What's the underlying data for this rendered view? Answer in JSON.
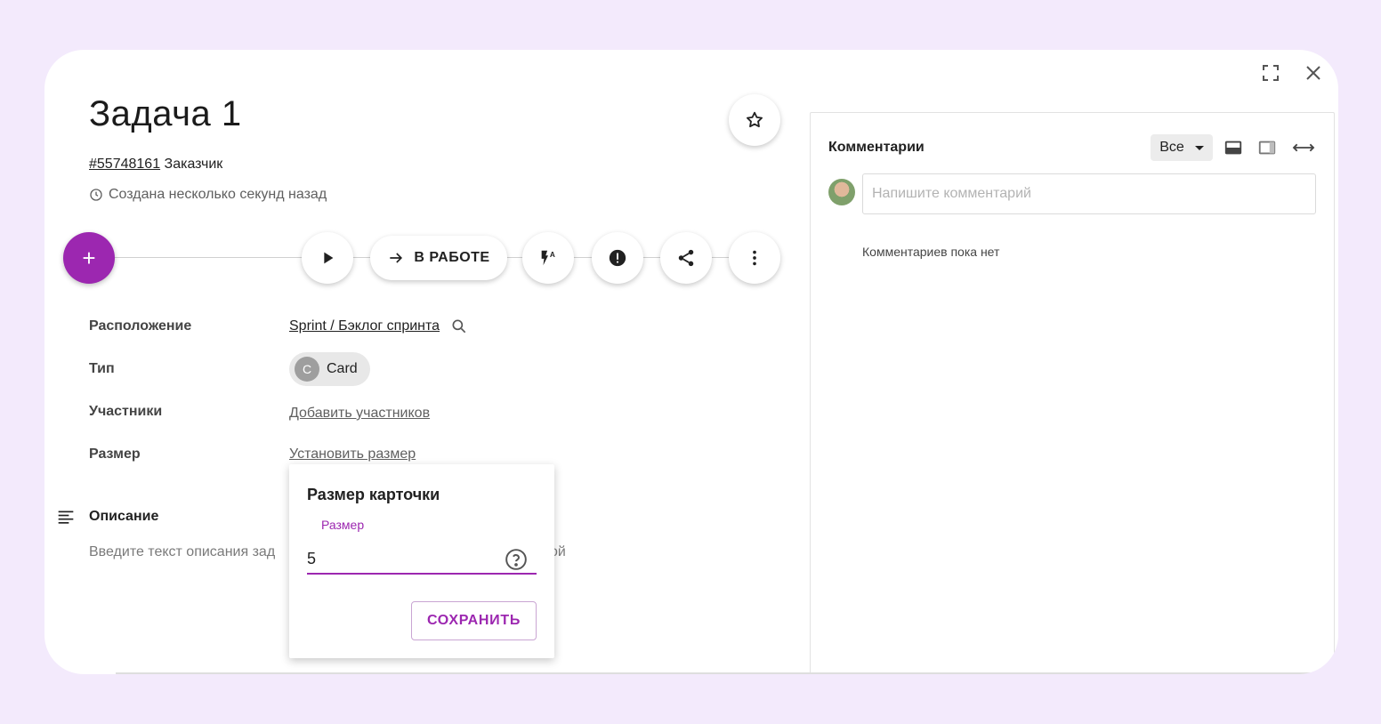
{
  "task": {
    "title": "Задача 1",
    "id": "#55748161",
    "customer": "Заказчик",
    "created": "Создана несколько секунд назад"
  },
  "actions": {
    "add_label": "+",
    "status_label": "В РАБОТЕ"
  },
  "fields": {
    "location_label": "Расположение",
    "location_value": "Sprint / Бэклог спринта",
    "type_label": "Тип",
    "type_initial": "C",
    "type_value": "Card",
    "members_label": "Участники",
    "members_value": "Добавить участников",
    "size_label": "Размер",
    "size_value": "Установить размер"
  },
  "description": {
    "title": "Описание",
    "placeholder": "Введите текст описания зад",
    "placeholder_tail": "ой"
  },
  "size_popup": {
    "title": "Размер карточки",
    "field_label": "Размер",
    "value": "5",
    "save_label": "СОХРАНИТЬ"
  },
  "comments": {
    "title": "Комментарии",
    "filter": "Все",
    "input_placeholder": "Напишите комментарий",
    "empty_text": "Комментариев пока нет"
  },
  "colors": {
    "accent": "#9c27b0",
    "background": "#f3eafc"
  }
}
